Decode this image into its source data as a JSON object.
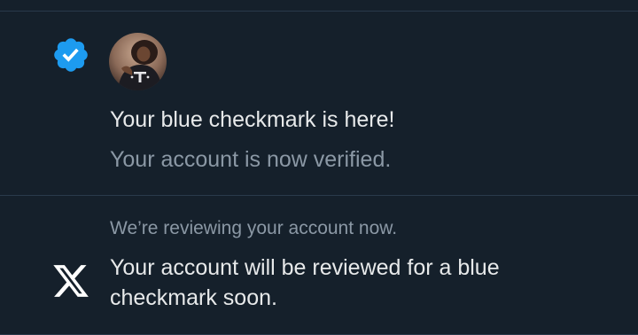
{
  "colors": {
    "background": "#15202b",
    "divider": "#2a3a4b",
    "primary_text": "#e7e9ea",
    "secondary_text": "#8b98a5",
    "verified_blue": "#1d9bf0"
  },
  "notifications": [
    {
      "icon": "verified-badge-icon",
      "avatar": "user-avatar",
      "title": "Your blue checkmark is here!",
      "subtitle": "Your account is now verified."
    },
    {
      "icon": "x-logo-icon",
      "header": "We’re reviewing your account now.",
      "body": "Your account will be reviewed for a blue checkmark soon."
    }
  ]
}
